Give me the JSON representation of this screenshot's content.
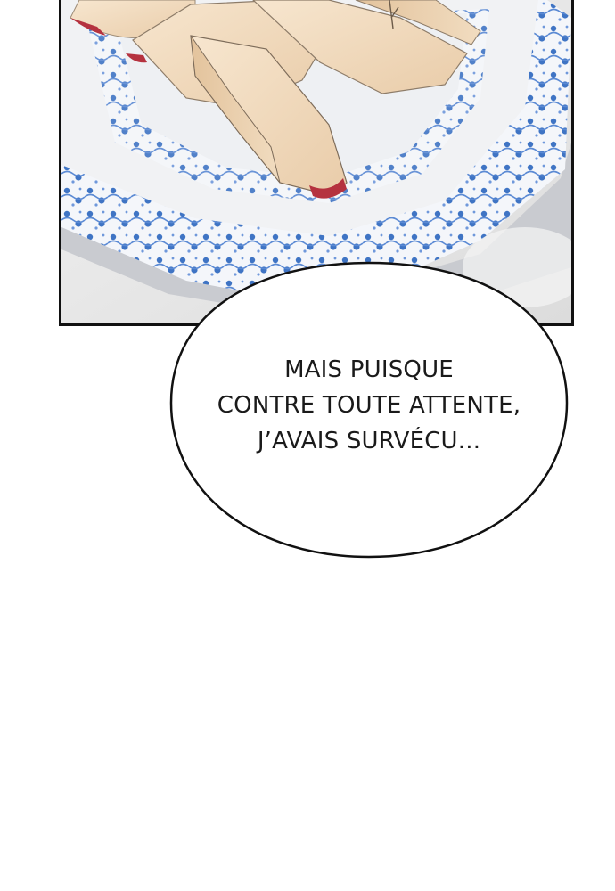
{
  "panel": {
    "illustration": "plate-of-sliced-apples-on-blue-patterned-porcelain"
  },
  "speech_bubble": {
    "lines": [
      "MAIS PUISQUE",
      "CONTRE TOUTE ATTENTE,",
      "J’AVAIS SURVÉCU..."
    ]
  },
  "colors": {
    "plate_blue": "#3f74c4",
    "plate_white": "#f4f6fa",
    "apple_flesh": "#f3dcc0",
    "apple_skin": "#b5323f",
    "tablecloth": "#e6e6e6",
    "outline": "#111111"
  }
}
